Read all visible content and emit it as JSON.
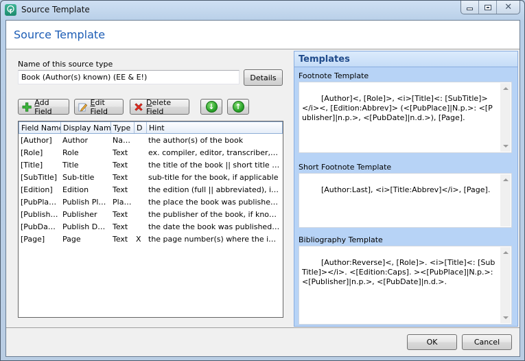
{
  "window": {
    "title": "Source Template",
    "controls": {
      "minimize": "minimize",
      "maximize": "maximize",
      "close": "close"
    }
  },
  "header": {
    "title": "Source Template"
  },
  "source_type": {
    "label": "Name of this source type",
    "value": "Book (Author(s) known) (EE & E!)",
    "details_button": "Details"
  },
  "toolbar": {
    "add_field": {
      "accel": "A",
      "rest": "dd Field",
      "icon": "plus-icon"
    },
    "edit_field": {
      "accel": "E",
      "rest": "dit Field",
      "icon": "pencil-icon"
    },
    "delete_field": {
      "accel": "D",
      "rest": "elete Field",
      "icon": "x-icon"
    },
    "move_down": {
      "icon": "arrow-down-icon",
      "glyph": "↓"
    },
    "move_up": {
      "icon": "arrow-up-icon",
      "glyph": "↑"
    }
  },
  "fields_table": {
    "columns": [
      "Field Name",
      "Display Name",
      "Type",
      "D",
      "Hint"
    ],
    "rows": [
      [
        "[Author]",
        "Author",
        "Name",
        "",
        "the author(s) of the book"
      ],
      [
        "[Role]",
        "Role",
        "Text",
        "",
        "ex. compiler, editor, transcriber, abst..."
      ],
      [
        "[Title]",
        "Title",
        "Text",
        "",
        "the title of the book || short title (if n..."
      ],
      [
        "[SubTitle]",
        "Sub-title",
        "Text",
        "",
        "sub-title for the book, if applicable"
      ],
      [
        "[Edition]",
        "Edition",
        "Text",
        "",
        "the edition (full || abbreviated), i.e. \"..."
      ],
      [
        "[PubPlace]",
        "Publish Place",
        "Place",
        "",
        "the place the book was published, if k..."
      ],
      [
        "[Publisher]",
        "Publisher",
        "Text",
        "",
        "the publisher of the book, if known; n..."
      ],
      [
        "[PubDate]",
        "Publish Date",
        "Text",
        "",
        "the date the book was published, if k..."
      ],
      [
        "[Page]",
        "Page",
        "Text",
        "X",
        "the page number(s) where the inform..."
      ]
    ]
  },
  "templates": {
    "title": "Templates",
    "footnote": {
      "label": "Footnote Template",
      "value": "[Author]<, [Role]>, <i>[Title]<: [SubTitle]></i><, [Edition:Abbrev]> (<[PubPlace]|N.p.>: <[Publisher]|n.p.>, <[PubDate]|n.d.>), [Page]."
    },
    "short_footnote": {
      "label": "Short Footnote Template",
      "value": "[Author:Last], <i>[Title:Abbrev]</i>, [Page]."
    },
    "bibliography": {
      "label": "Bibliography Template",
      "value": "[Author:Reverse]<, [Role]>. <i>[Title]<: [SubTitle]></i>. <[Edition:Caps]. ><[PubPlace]|N.p.>: <[Publisher]|n.p.>, <[PubDate]|n.d.>."
    }
  },
  "footer": {
    "ok": "OK",
    "cancel": "Cancel"
  }
}
